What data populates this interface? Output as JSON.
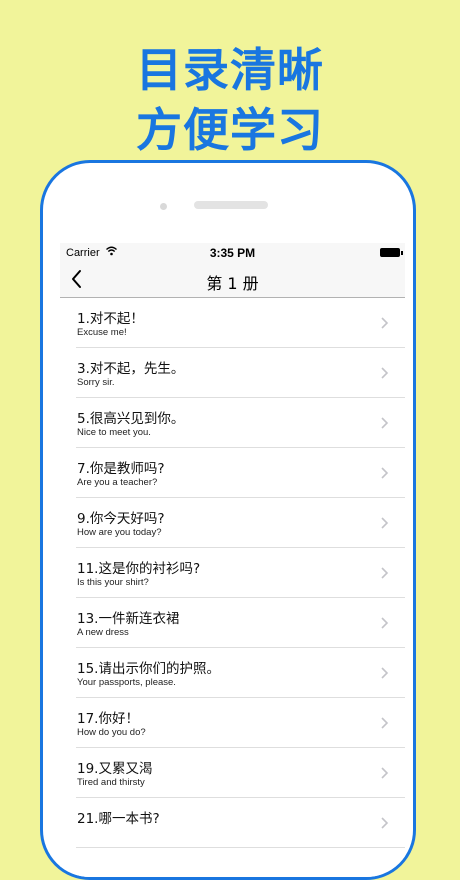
{
  "headline": {
    "line1": "目录清晰",
    "line2": "方便学习"
  },
  "status_bar": {
    "carrier": "Carrier",
    "time": "3:35 PM"
  },
  "nav": {
    "title": "第 1 册",
    "back_icon": "chevron-left-icon"
  },
  "lessons": [
    {
      "zh": "1.对不起！",
      "en": "Excuse me!"
    },
    {
      "zh": "3.对不起，先生。",
      "en": "Sorry sir."
    },
    {
      "zh": "5.很高兴见到你。",
      "en": "Nice to meet you."
    },
    {
      "zh": "7.你是教师吗?",
      "en": "Are you a teacher?"
    },
    {
      "zh": "9.你今天好吗?",
      "en": "How are you today?"
    },
    {
      "zh": "11.这是你的衬衫吗?",
      "en": "Is this your shirt?"
    },
    {
      "zh": "13.一件新连衣裙",
      "en": "A new dress"
    },
    {
      "zh": "15.请出示你们的护照。",
      "en": "Your passports, please."
    },
    {
      "zh": "17.你好！",
      "en": "How do you do?"
    },
    {
      "zh": "19.又累又渴",
      "en": "Tired and thirsty"
    },
    {
      "zh": "21.哪一本书?",
      "en": ""
    }
  ],
  "colors": {
    "background": "#f1f49a",
    "accent": "#1976e0"
  }
}
